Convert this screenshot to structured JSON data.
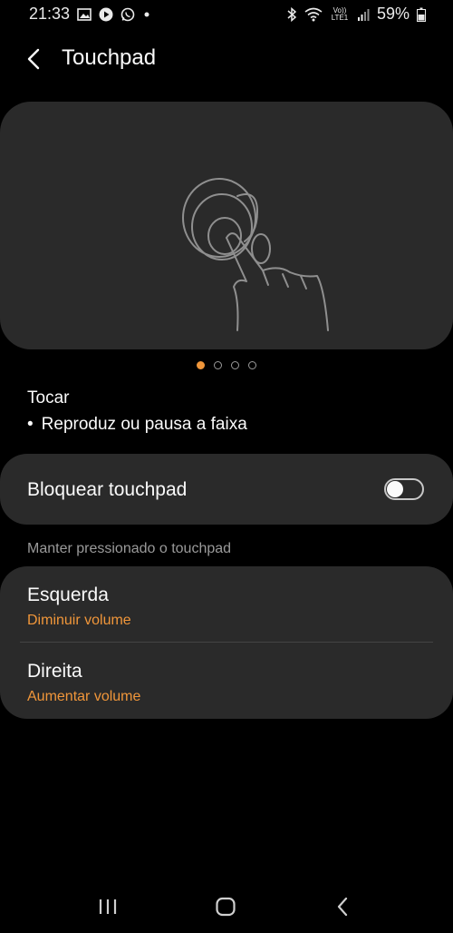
{
  "status_bar": {
    "time": "21:33",
    "left_icons": [
      "gallery-icon",
      "play-icon",
      "whatsapp-icon",
      "dot-icon"
    ],
    "right_icons": [
      "bluetooth-icon",
      "wifi-icon",
      "volte-icon",
      "signal-icon"
    ],
    "volte_label": "Vo)) LTE1",
    "battery": "59%"
  },
  "header": {
    "title": "Touchpad"
  },
  "illustration": {
    "pages": 4,
    "active_page": 0
  },
  "gesture": {
    "title": "Tocar",
    "bullet": "•",
    "description": "Reproduz ou pausa a faixa"
  },
  "lock_touchpad": {
    "label": "Bloquear touchpad",
    "enabled": false
  },
  "hold_section": {
    "header": "Manter pressionado o touchpad",
    "items": [
      {
        "title": "Esquerda",
        "value": "Diminuir volume"
      },
      {
        "title": "Direita",
        "value": "Aumentar volume"
      }
    ]
  },
  "colors": {
    "accent": "#f0963a",
    "card": "#2a2a2a",
    "background": "#000000"
  }
}
